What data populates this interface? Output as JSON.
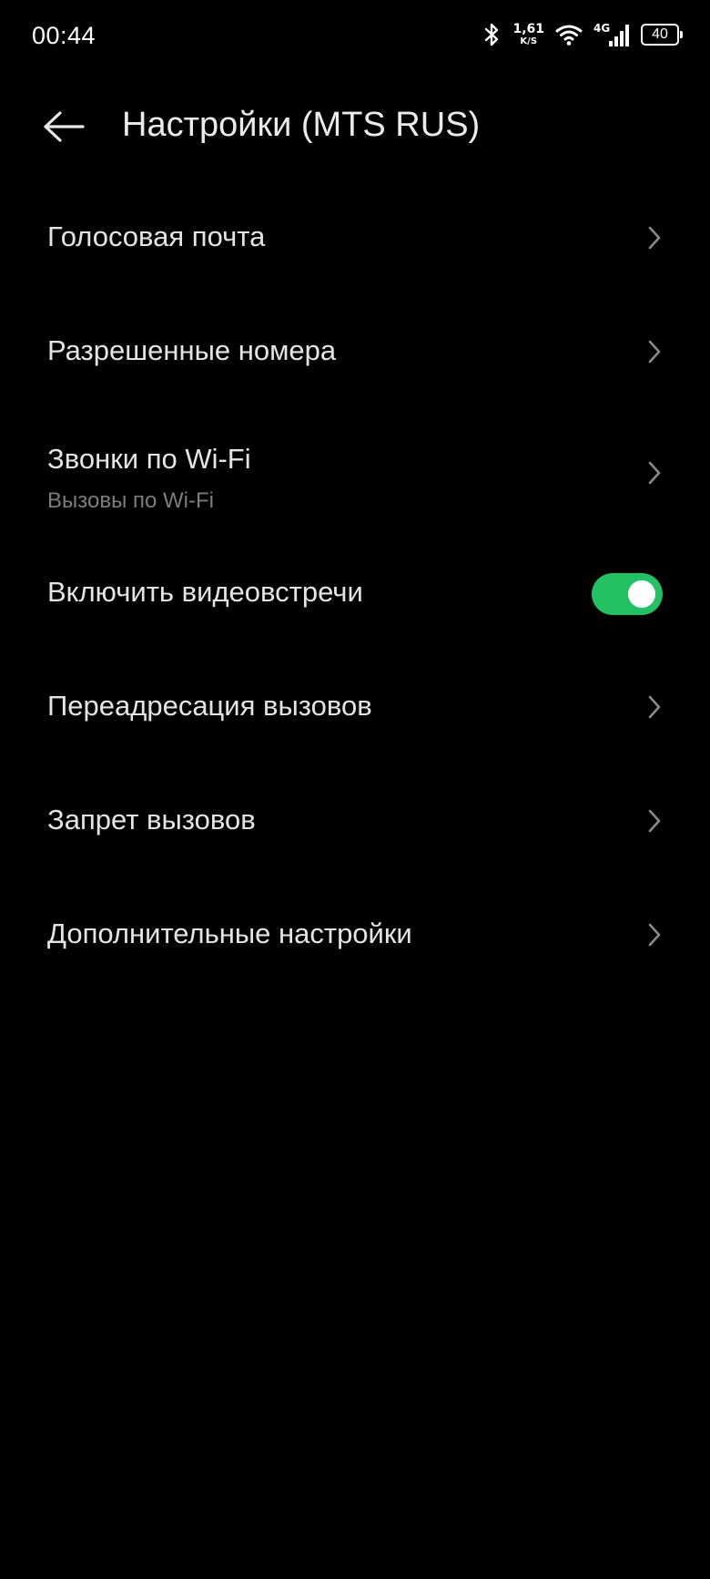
{
  "status_bar": {
    "time": "00:44",
    "net_speed_value": "1,61",
    "net_speed_unit": "K/S",
    "network_type": "4G",
    "battery_level": "40",
    "icons": [
      "bluetooth-icon",
      "wifi-icon",
      "cellular-signal-icon",
      "battery-icon"
    ]
  },
  "header": {
    "title": "Настройки (MTS RUS)",
    "back_icon": "arrow-left-icon"
  },
  "settings": {
    "items": [
      {
        "label": "Голосовая почта",
        "control": "chevron"
      },
      {
        "label": "Разрешенные номера",
        "control": "chevron"
      },
      {
        "label": "Звонки по Wi-Fi",
        "subtitle": "Вызовы по Wi-Fi",
        "control": "chevron"
      },
      {
        "label": "Включить видеовстречи",
        "control": "toggle",
        "toggle_on": true
      },
      {
        "label": "Переадресация вызовов",
        "control": "chevron"
      },
      {
        "label": "Запрет вызовов",
        "control": "chevron"
      },
      {
        "label": "Дополнительные настройки",
        "control": "chevron"
      }
    ]
  },
  "colors": {
    "background": "#000000",
    "text_primary": "#e4e4e4",
    "text_secondary": "#7d7d7d",
    "chevron": "#8a8a8a",
    "toggle_on": "#23c064"
  }
}
